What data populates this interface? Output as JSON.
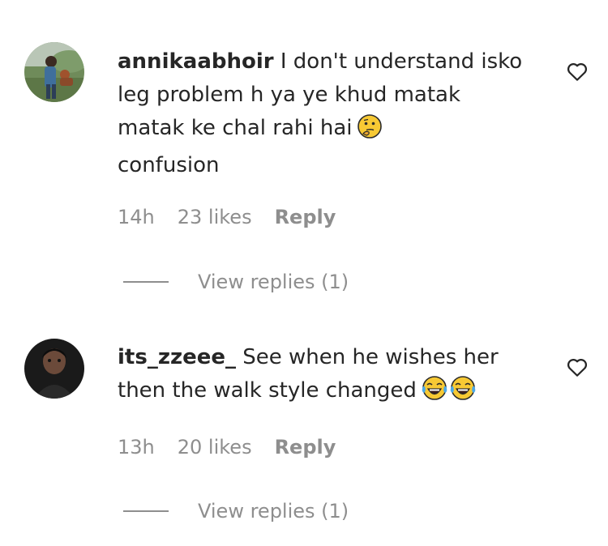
{
  "comments": [
    {
      "username": "annikaabhoir",
      "text": "I don't understand isko leg problem h ya ye khud matak matak ke chal rahi hai",
      "text_tail": "confusion",
      "emojis": [
        "thinking-face"
      ],
      "time": "14h",
      "likes": "23 likes",
      "reply_label": "Reply",
      "view_replies": "View replies (1)"
    },
    {
      "username": "its_zzeee_",
      "text": "See when he wishes her then the walk style changed",
      "emojis": [
        "tears-of-joy",
        "tears-of-joy"
      ],
      "time": "13h",
      "likes": "20 likes",
      "reply_label": "Reply",
      "view_replies": "View replies (1)"
    }
  ],
  "colors": {
    "text": "#262626",
    "muted": "#8e8e8e"
  }
}
